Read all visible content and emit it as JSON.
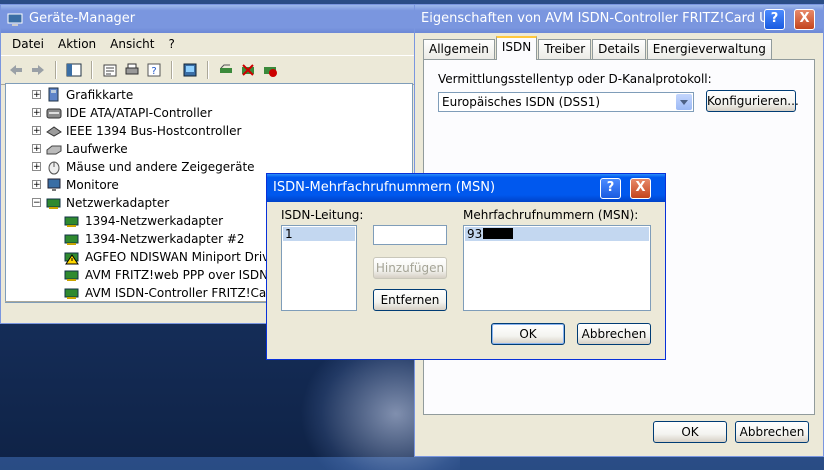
{
  "device_manager": {
    "title": "Geräte-Manager",
    "menu": [
      "Datei",
      "Aktion",
      "Ansicht",
      "?"
    ],
    "tree": [
      {
        "label": "Grafikkarte",
        "expander": "+",
        "icon": "display-adapter-icon"
      },
      {
        "label": "IDE ATA/ATAPI-Controller",
        "expander": "+",
        "icon": "ide-controller-icon"
      },
      {
        "label": "IEEE 1394 Bus-Hostcontroller",
        "expander": "+",
        "icon": "firewire-controller-icon"
      },
      {
        "label": "Laufwerke",
        "expander": "+",
        "icon": "disk-drive-icon"
      },
      {
        "label": "Mäuse und andere Zeigegeräte",
        "expander": "+",
        "icon": "mouse-icon"
      },
      {
        "label": "Monitore",
        "expander": "+",
        "icon": "monitor-icon"
      },
      {
        "label": "Netzwerkadapter",
        "expander": "−",
        "icon": "network-adapter-icon"
      },
      {
        "label": "1394-Netzwerkadapter",
        "icon": "network-card-icon"
      },
      {
        "label": "1394-Netzwerkadapter #2",
        "icon": "network-card-icon"
      },
      {
        "label": "AGFEO NDISWAN Miniport Driver",
        "icon": "network-card-warning-icon"
      },
      {
        "label": "AVM FRITZ!web PPP over ISDN",
        "icon": "network-card-icon"
      },
      {
        "label": "AVM ISDN-Controller FRITZ!Card",
        "icon": "network-card-icon"
      }
    ]
  },
  "properties": {
    "title": "Eigenschaften von AVM ISDN-Controller FRITZ!Card U...",
    "help_button": "?",
    "close_button": "X",
    "tabs": [
      "Allgemein",
      "ISDN",
      "Treiber",
      "Details",
      "Energieverwaltung"
    ],
    "selected_tab": "ISDN",
    "protocol_label": "Vermittlungsstellentyp oder D-Kanalprotokoll:",
    "protocol_value": "Europäisches ISDN (DSS1)",
    "configure_button": "Konfigurieren...",
    "ok_button": "OK",
    "cancel_button": "Abbrechen"
  },
  "msn_dialog": {
    "title": "ISDN-Mehrfachrufnummern (MSN)",
    "help_button": "?",
    "close_button": "X",
    "line_label": "ISDN-Leitung:",
    "lines": [
      "1"
    ],
    "input_value": "",
    "add_button": "Hinzufügen",
    "remove_button": "Entfernen",
    "msn_label": "Mehrfachrufnummern (MSN):",
    "msn_values": [
      "93"
    ],
    "ok_button": "OK",
    "cancel_button": "Abbrechen"
  },
  "colors": {
    "xp_blue": "#0058ee",
    "window_face": "#ece9d8",
    "selection": "#c3d7f0",
    "redaction": "#000000"
  }
}
